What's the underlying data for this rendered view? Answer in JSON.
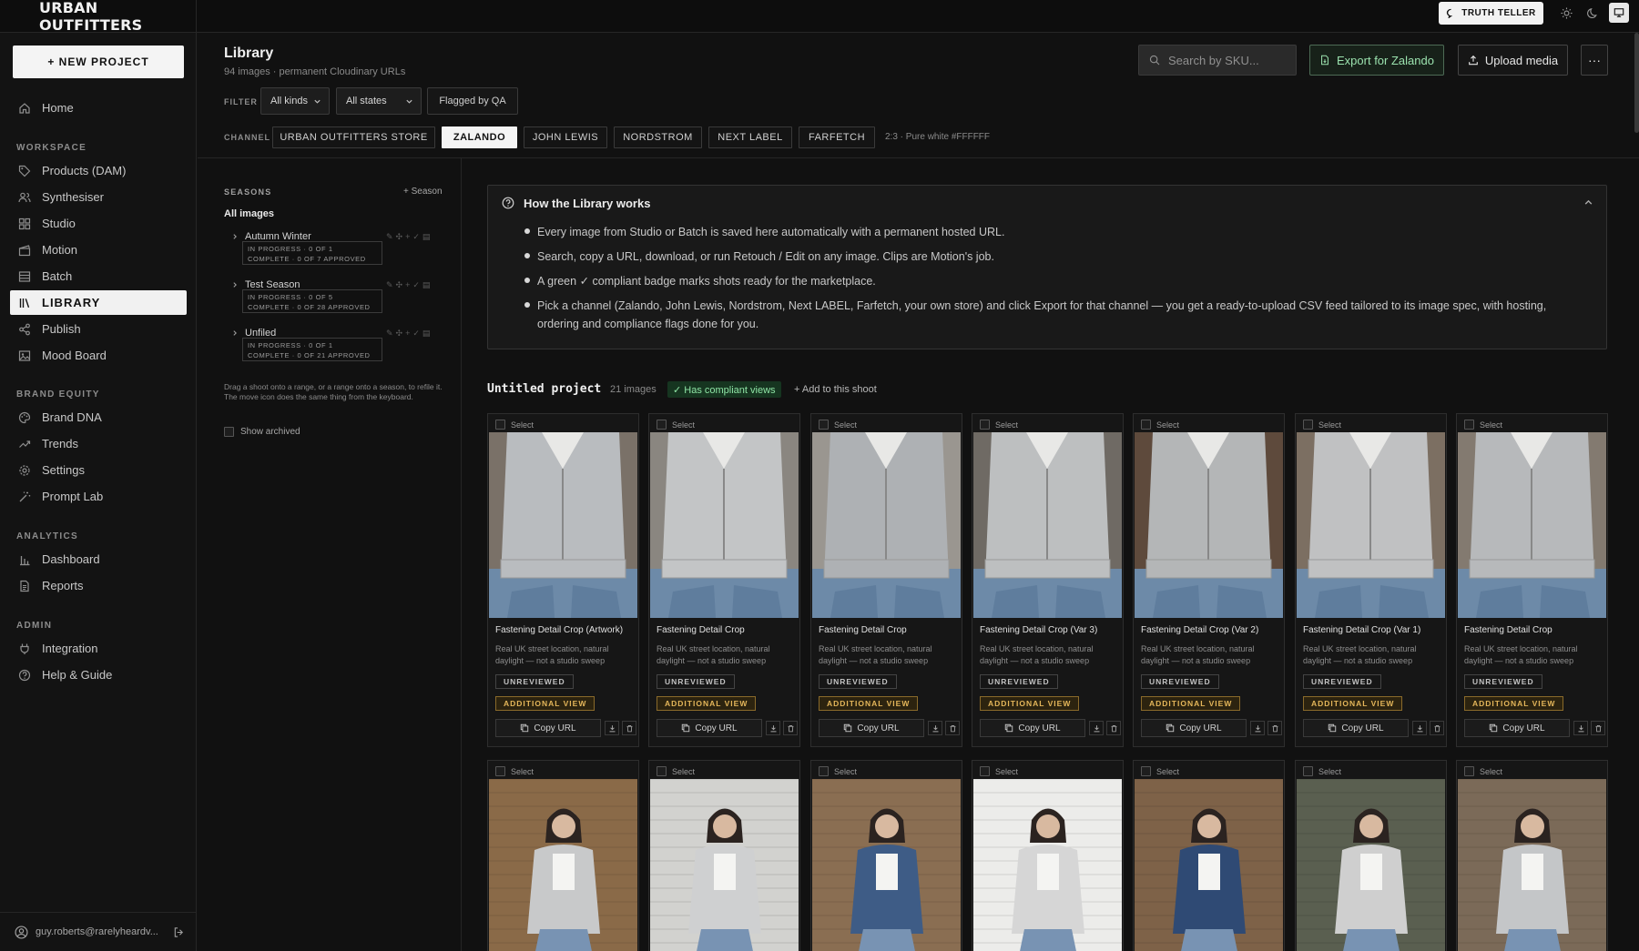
{
  "brand": "URBAN OUTFITTERS",
  "topbar": {
    "truth_teller": "TRUTH TELLER",
    "icons": [
      "sun-icon",
      "moon-icon",
      "monitor-icon"
    ]
  },
  "sidebar": {
    "new_project": "+ NEW PROJECT",
    "home": "Home",
    "sections": {
      "workspace": "WORKSPACE",
      "brand_equity": "BRAND EQUITY",
      "analytics": "ANALYTICS",
      "admin": "ADMIN"
    },
    "workspace": [
      "Products (DAM)",
      "Synthesiser",
      "Studio",
      "Motion",
      "Batch",
      "LIBRARY",
      "Publish",
      "Mood Board"
    ],
    "brand_equity": [
      "Brand DNA",
      "Trends",
      "Settings",
      "Prompt Lab"
    ],
    "analytics": [
      "Dashboard",
      "Reports"
    ],
    "admin": [
      "Integration",
      "Help & Guide"
    ],
    "user": "guy.roberts@rarelyheardv..."
  },
  "header": {
    "title": "Library",
    "subtitle": "94 images · permanent Cloudinary URLs",
    "filter_label": "FILTER",
    "kind_value": "All kinds",
    "state_value": "All states",
    "flagged": "Flagged by QA",
    "channel_label": "CHANNEL",
    "channels": [
      "URBAN OUTFITTERS STORE",
      "ZALANDO",
      "JOHN LEWIS",
      "NORDSTROM",
      "NEXT LABEL",
      "FARFETCH"
    ],
    "active_channel": "ZALANDO",
    "channel_spec": "2:3 · Pure white #FFFFFF",
    "search_placeholder": "Search by SKU...",
    "export": "Export for Zalando",
    "upload": "Upload media",
    "more": "···"
  },
  "seasons": {
    "title": "SEASONS",
    "add": "+ Season",
    "all_images": "All images",
    "items": [
      {
        "name": "Autumn Winter",
        "line1": "IN PROGRESS · 0 OF 1",
        "line2": "COMPLETE · 0 OF 7 APPROVED"
      },
      {
        "name": "Test Season",
        "line1": "IN PROGRESS · 0 OF 5",
        "line2": "COMPLETE · 0 OF 28 APPROVED"
      },
      {
        "name": "Unfiled",
        "line1": "IN PROGRESS · 0 OF 1",
        "line2": "COMPLETE · 0 OF 21 APPROVED"
      }
    ],
    "hint": "Drag a shoot onto a range, or a range onto a season, to refile it. The move icon does the same thing from the keyboard.",
    "show_archived": "Show archived"
  },
  "info": {
    "title": "How the Library works",
    "bullets": [
      "Every image from Studio or Batch is saved here automatically with a permanent hosted URL.",
      "Search, copy a URL, download, or run Retouch / Edit on any image. Clips are Motion's job.",
      "A green ✓ compliant badge marks shots ready for the marketplace.",
      "Pick a channel (Zalando, John Lewis, Nordstrom, Next LABEL, Farfetch, your own store) and click Export for that channel — you get a ready-to-upload CSV feed tailored to its image spec, with hosting, ordering and compliance flags done for you."
    ]
  },
  "project": {
    "name": "Untitled project",
    "count": "21 images",
    "compliant": "✓ Has compliant views",
    "add": "+ Add to this shoot"
  },
  "card_common": {
    "select": "Select",
    "desc": "Real UK street location, natural daylight — not a studio sweep",
    "unreviewed": "UNREVIEWED",
    "additional": "ADDITIONAL VIEW",
    "copy": "Copy URL"
  },
  "cards": [
    {
      "title": "Fastening Detail Crop (Artwork)"
    },
    {
      "title": "Fastening Detail Crop"
    },
    {
      "title": "Fastening Detail Crop"
    },
    {
      "title": "Fastening Detail Crop (Var 3)"
    },
    {
      "title": "Fastening Detail Crop (Var 2)"
    },
    {
      "title": "Fastening Detail Crop (Var 1)"
    },
    {
      "title": "Fastening Detail Crop"
    }
  ]
}
